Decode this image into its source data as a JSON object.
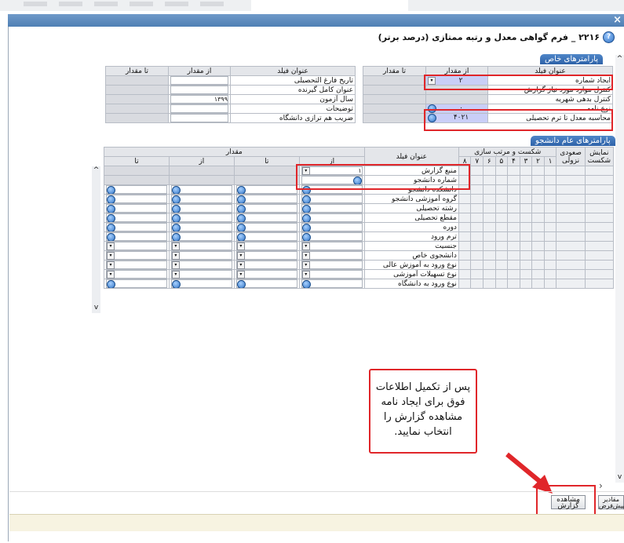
{
  "window": {
    "close_glyph": "×"
  },
  "form": {
    "title": "۲۲۱۶ _ فرم گواهی معدل و رتبه ممتازی (درصد برتر)"
  },
  "special_params": {
    "header": "پارامترهای خاص",
    "left_table": {
      "columns": [
        "تا مقدار",
        "از مقدار",
        "عنوان فیلد"
      ],
      "rows": [
        {
          "label": "تاریخ فارغ التحصیلی",
          "from": ""
        },
        {
          "label": "عنوان کامل گیرنده",
          "from": ""
        },
        {
          "label": "سال آزمون",
          "from": "۱۳۹۹"
        },
        {
          "label": "توضیحات",
          "from": ""
        },
        {
          "label": "ضریب هم ترازی دانشگاه",
          "from": ""
        }
      ]
    },
    "right_table": {
      "columns": [
        "تا مقدار",
        "از مقدار",
        "عنوان فیلد"
      ],
      "rows": [
        {
          "label": "ایجاد شماره",
          "from": "۲"
        },
        {
          "label": "کنترل موارد مورد نیاز گزارش",
          "from": ""
        },
        {
          "label": "کنترل بدهی شهریه",
          "from": ""
        },
        {
          "label": "نوع نامه",
          "from": "۰"
        },
        {
          "label": "محاسبه معدل تا ترم تحصیلی",
          "from": "۴۰۲۱"
        }
      ]
    }
  },
  "student_params": {
    "header": "پارامترهای عام دانشجو",
    "col_show": "نمایش شکست",
    "col_asc": "صعودی نزولی",
    "col_sort": "شکست و مرتب سازی",
    "col_field": "عنوان فیلد",
    "col_value": "مقدار",
    "sub_to": "تا",
    "sub_from": "از",
    "sort_numbers": [
      "۸",
      "۷",
      "۶",
      "۵",
      "۴",
      "۳",
      "۲",
      "۱"
    ],
    "rows": [
      {
        "label": "منبع گزارش",
        "from": "۱"
      },
      {
        "label": "شماره دانشجو"
      },
      {
        "label": "دانشکده دانشجو"
      },
      {
        "label": "گروه آموزشی دانشجو"
      },
      {
        "label": "رشته تحصیلی"
      },
      {
        "label": "مقطع تحصیلی"
      },
      {
        "label": "دوره"
      },
      {
        "label": "ترم ورود"
      },
      {
        "label": "جنسیت"
      },
      {
        "label": "دانشجوی خاص"
      },
      {
        "label": "نوع ورود به آموزش عالی"
      },
      {
        "label": "نوع تسهیلات آموزشی"
      },
      {
        "label": "نوع ورود به دانشگاه"
      }
    ]
  },
  "callout": {
    "text": "پس از تکمیل اطلاعات فوق برای ایجاد نامه مشاهده گزارش را انتخاب نمایید."
  },
  "footer": {
    "view_report_label": "مشاهده گزارش",
    "default_values_label": "مقادیر پیش‌فرض",
    "scroll_left_glyph": "›"
  },
  "colors": {
    "highlight_red": "#e0262a",
    "header_blue": "#2e62a8",
    "input_blue": "#c9cef7"
  }
}
